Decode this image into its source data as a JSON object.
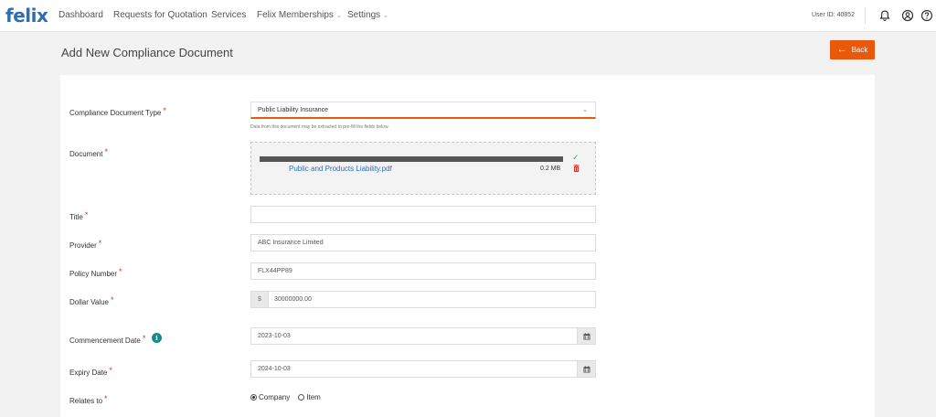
{
  "app": {
    "logo": "felix"
  },
  "nav": {
    "items": [
      {
        "label": "Dashboard"
      },
      {
        "label": "Requests for Quotation"
      },
      {
        "label": "Services"
      },
      {
        "label": "Felix Memberships",
        "dropdown": true
      },
      {
        "label": "Settings",
        "dropdown": true
      }
    ],
    "user_id": "User ID: 40852",
    "icons": [
      "bell-icon",
      "user-icon",
      "help-icon"
    ]
  },
  "page": {
    "title": "Add New Compliance Document",
    "back_label": "Back"
  },
  "form": {
    "doc_type": {
      "label": "Compliance Document Type",
      "value": "Public Liability Insurance",
      "hint": "Data from this document may be extracted to pre-fill the fields below."
    },
    "document": {
      "label": "Document",
      "file_name": "Public and Products Liability.pdf",
      "file_size": "0.2 MB",
      "upload_progress": 1.0
    },
    "title": {
      "label": "Title",
      "value": ""
    },
    "provider": {
      "label": "Provider",
      "value": "ABC Insurance Limited"
    },
    "policy_number": {
      "label": "Policy Number",
      "value": "FLX44PP89"
    },
    "dollar_value": {
      "label": "Dollar Value",
      "prefix": "$",
      "value": "30000000.00"
    },
    "commencement_date": {
      "label": "Commencement Date",
      "value": "2023-10-03"
    },
    "expiry_date": {
      "label": "Expiry Date",
      "value": "2024-10-03"
    },
    "relates_to": {
      "label": "Relates to",
      "options": [
        "Company",
        "Item"
      ],
      "selected": "Company"
    }
  },
  "colors": {
    "brand_blue": "#2d6fb7",
    "accent_orange": "#e8590c",
    "required_red": "#d9322f",
    "info_teal": "#178a8a"
  }
}
